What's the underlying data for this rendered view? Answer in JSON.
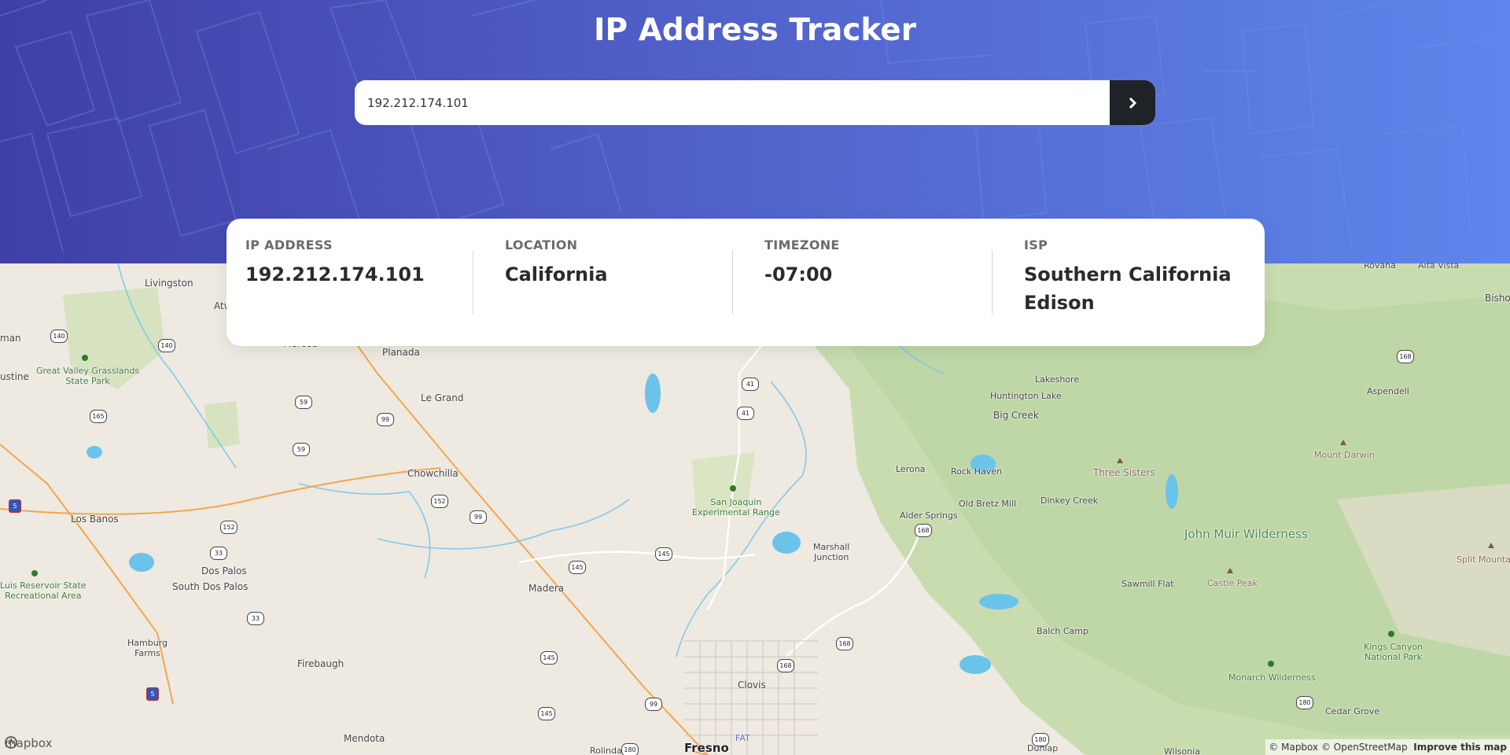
{
  "header": {
    "title": "IP Address Tracker"
  },
  "search": {
    "value": "192.212.174.101",
    "button_icon": "chevron-right-icon"
  },
  "info": {
    "ip_label": "IP ADDRESS",
    "ip_value": "192.212.174.101",
    "location_label": "LOCATION",
    "location_value": "California",
    "timezone_label": "TIMEZONE",
    "timezone_value": "-07:00",
    "isp_label": "ISP",
    "isp_value": "Southern California Edison"
  },
  "map": {
    "places": {
      "livingston": "Livingston",
      "atwater": "Atw",
      "merced": "Merced",
      "planada": "Planada",
      "le_grand": "Le Grand",
      "chowchilla": "Chowchilla",
      "los_banos": "Los Banos",
      "dos_palos": "Dos Palos",
      "south_dos_palos": "South Dos Palos",
      "madera": "Madera",
      "firebaugh": "Firebaugh",
      "mendota": "Mendota",
      "hamburg_farms": "Hamburg\nFarms",
      "clovis": "Clovis",
      "fresno": "Fresno",
      "fat": "FAT",
      "rolinda": "Rolinda",
      "marshall_junction": "Marshall\nJunction",
      "alder_springs": "Alder Springs",
      "old_bretz_mill": "Old Bretz Mill",
      "rock_haven": "Rock Haven",
      "lerona": "Lerona",
      "dinkey_creek": "Dinkey Creek",
      "big_creek": "Big Creek",
      "huntington_lake": "Huntington Lake",
      "lakeshore": "Lakeshore",
      "three_sisters": "Three Sisters",
      "sawmill_flat": "Sawmill Flat",
      "castle_peak": "Castle Peak",
      "balch_camp": "Balch Camp",
      "cedar_grove": "Cedar Grove",
      "dunlap": "Dunlap",
      "wilsonia": "Wilsonia",
      "aspendell": "Aspendell",
      "mount_darwin": "Mount Darwin",
      "split_mountain": "Split Mountain",
      "rovana": "Rovana",
      "alta_vista": "Alta Vista",
      "bishop": "Bishop",
      "gustine": "ustine",
      "newman": "man",
      "great_valley": "Great Valley Grasslands\nState Park",
      "san_luis": "Luis Reservoir State\nRecreational Area",
      "san_joaquin": "San Joaquin\nExperimental Range",
      "john_muir": "John Muir Wilderness",
      "monarch": "Monarch Wilderness",
      "kings_canyon": "Kings Canyon\nNational Park"
    },
    "routes": [
      "140",
      "140",
      "59",
      "59",
      "99",
      "99",
      "165",
      "152",
      "152",
      "33",
      "33",
      "5",
      "5",
      "41",
      "41",
      "145",
      "145",
      "145",
      "145",
      "99",
      "168",
      "168",
      "168",
      "168",
      "180",
      "180",
      "180"
    ],
    "logo_text": "mapbox",
    "attribution": "© Mapbox © OpenStreetMap",
    "improve": "Improve this map"
  }
}
